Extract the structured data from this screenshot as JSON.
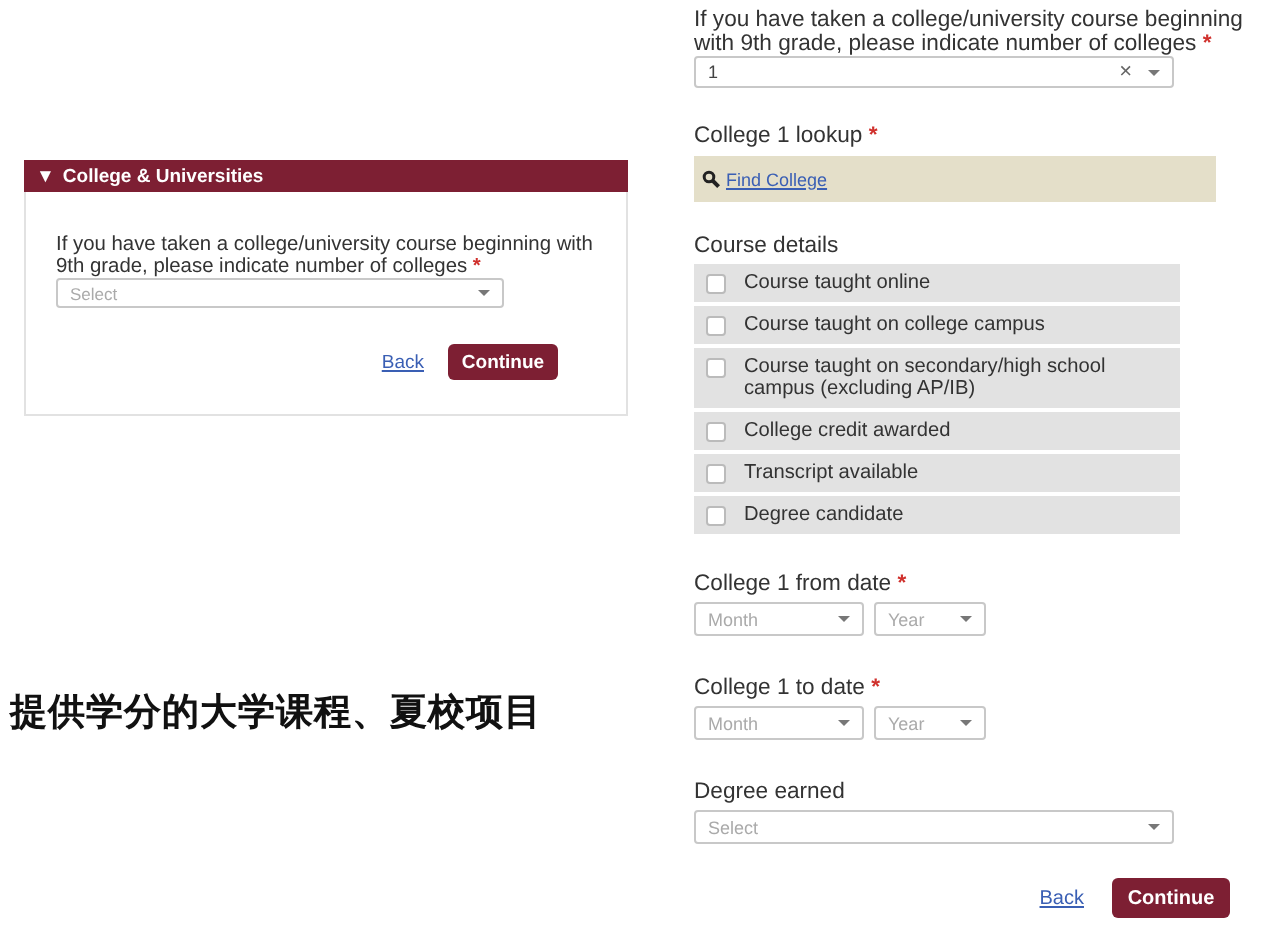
{
  "left_panel": {
    "header_icon": "▼",
    "header": "College & Universities",
    "question": "If you have taken a college/university course beginning with 9th grade, please indicate number of colleges",
    "required_mark": "*",
    "select": {
      "placeholder": "Select"
    },
    "back": "Back",
    "continue": "Continue"
  },
  "caption": "提供学分的大学课程、夏校项目",
  "right_form": {
    "count_question": {
      "label": "If you have taken a college/university course beginning with 9th grade, please indicate number of colleges",
      "required_mark": "*",
      "value": "1",
      "clear": "×"
    },
    "lookup": {
      "label": "College 1 lookup",
      "required_mark": "*",
      "link": "Find College"
    },
    "course_details": {
      "label": "Course details",
      "options": [
        {
          "label": "Course taught online",
          "checked": false
        },
        {
          "label": "Course taught on college campus",
          "checked": false
        },
        {
          "label": "Course taught on secondary/high school campus (excluding AP/IB)",
          "checked": false
        },
        {
          "label": "College credit awarded",
          "checked": false
        },
        {
          "label": "Transcript available",
          "checked": false
        },
        {
          "label": "Degree candidate",
          "checked": false
        }
      ]
    },
    "from_date": {
      "label": "College 1 from date",
      "required_mark": "*",
      "month": {
        "placeholder": "Month"
      },
      "year": {
        "placeholder": "Year"
      }
    },
    "to_date": {
      "label": "College 1 to date",
      "required_mark": "*",
      "month": {
        "placeholder": "Month"
      },
      "year": {
        "placeholder": "Year"
      }
    },
    "degree": {
      "label": "Degree earned",
      "select": {
        "placeholder": "Select"
      }
    },
    "back": "Back",
    "continue": "Continue"
  }
}
